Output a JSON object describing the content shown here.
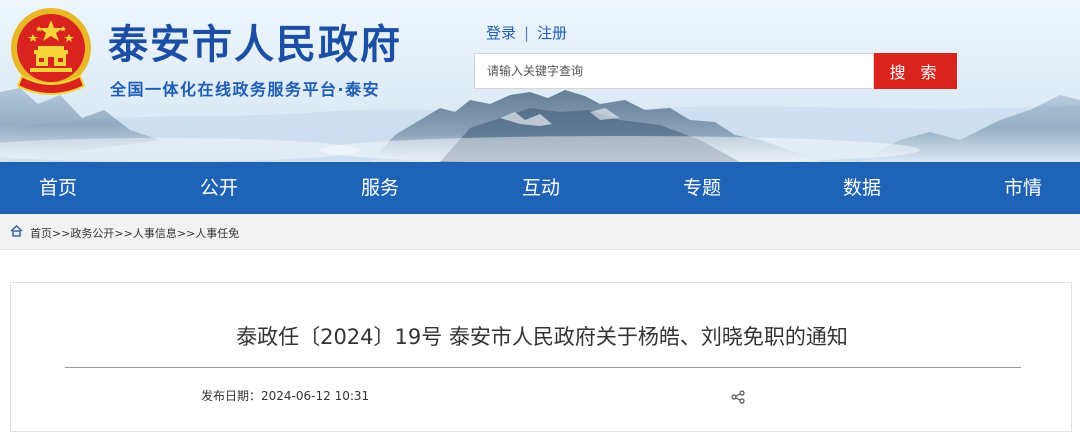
{
  "header": {
    "site_title": "泰安市人民政府",
    "site_subtitle": "全国一体化在线政务服务平台·泰安",
    "emblem_icon": "national-emblem-icon",
    "login_label": "登录",
    "separator": "|",
    "register_label": "注册",
    "search_placeholder": "请输入关键字查询",
    "search_button_label": "搜 索"
  },
  "nav": {
    "items": [
      {
        "label": "首页"
      },
      {
        "label": "公开"
      },
      {
        "label": "服务"
      },
      {
        "label": "互动"
      },
      {
        "label": "专题"
      },
      {
        "label": "数据"
      },
      {
        "label": "市情"
      }
    ]
  },
  "breadcrumb": {
    "home_icon": "home-icon",
    "text": "首页>>政务公开>>人事信息>>人事任免"
  },
  "article": {
    "title": "泰政任〔2024〕19号 泰安市人民政府关于杨皓、刘晓免职的通知",
    "date_label": "发布日期：",
    "date_value": "2024-06-12 10:31",
    "share_icon": "share-icon"
  },
  "colors": {
    "brand_blue": "#1f63b6",
    "title_blue": "#1c4fa3",
    "search_red": "#d8231e",
    "emblem_red": "#d8231e",
    "emblem_gold": "#f2c230"
  }
}
